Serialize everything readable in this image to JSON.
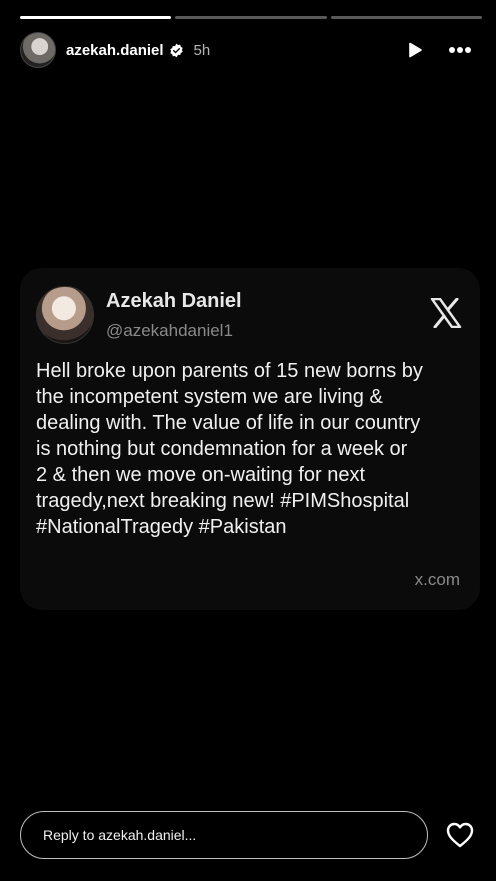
{
  "story": {
    "progress_segments": [
      {
        "fill": 1.0
      },
      {
        "fill": 0.0
      },
      {
        "fill": 0.0
      }
    ],
    "user": {
      "username": "azekah.daniel",
      "verified": true,
      "time": "5h"
    }
  },
  "tweet": {
    "display_name": "Azekah Daniel",
    "handle": "@azekahdaniel1",
    "text": "Hell broke upon parents of 15 new borns by\nthe incompetent system we are living &\ndealing with. The value of life in our country\nis nothing but condemnation for a week or\n2 & then we move on-waiting for next\ntragedy,next breaking new! #PIMShospital\n#NationalTragedy #Pakistan",
    "domain": "x.com"
  },
  "footer": {
    "reply_placeholder": "Reply to azekah.daniel..."
  },
  "icons": {
    "verified": "verified-badge-icon",
    "play": "play-icon",
    "more": "more-horizontal-icon",
    "x_logo": "x-logo-icon",
    "heart": "heart-icon"
  }
}
